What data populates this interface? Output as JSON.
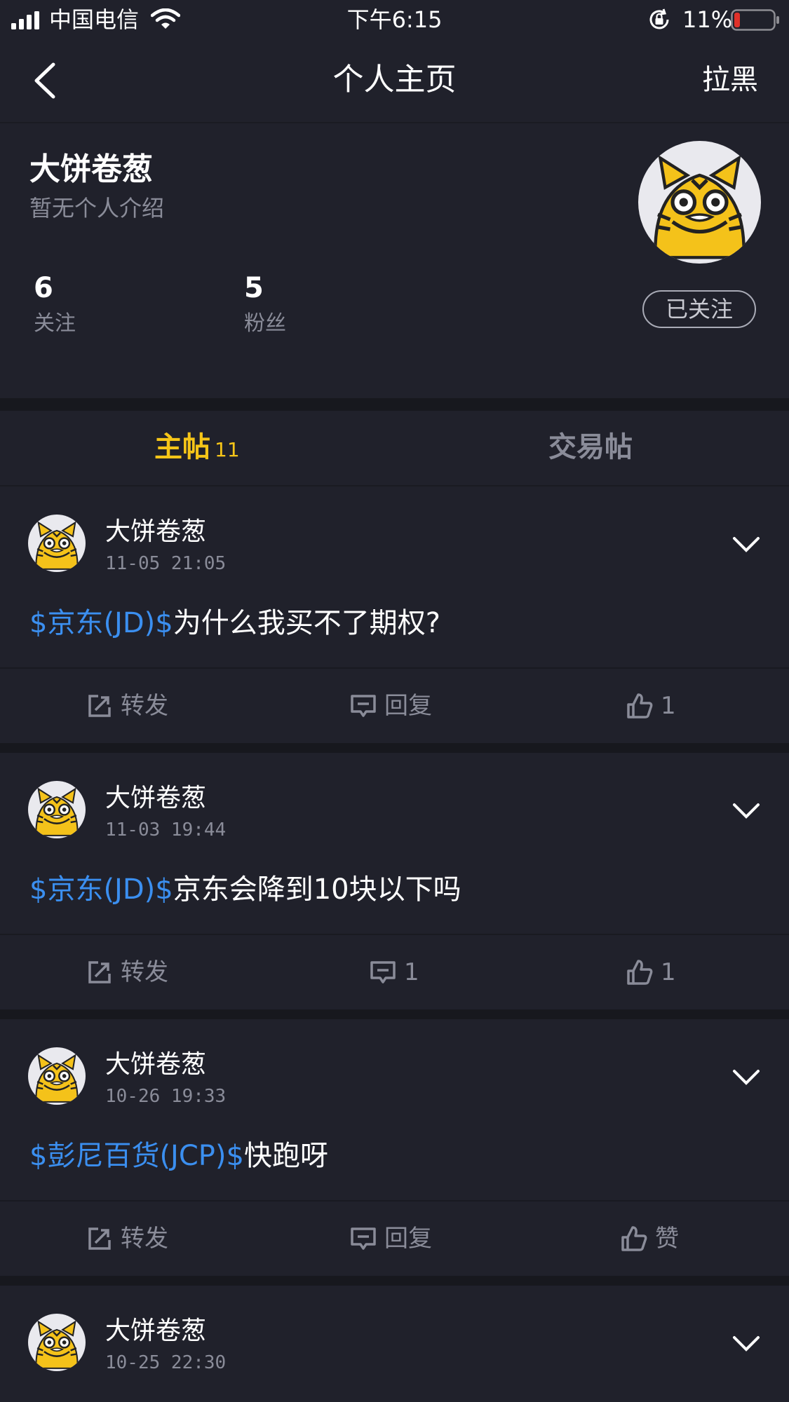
{
  "status_bar": {
    "carrier": "中国电信",
    "time": "下午6:15",
    "battery_pct": "11%",
    "battery_level": 0.11,
    "accent_battery": "#e0312a"
  },
  "navbar": {
    "back_icon": "chevron-left-icon",
    "title": "个人主页",
    "block_label": "拉黑"
  },
  "profile": {
    "name": "大饼卷葱",
    "bio": "暂无个人介绍",
    "following_count": "6",
    "following_label": "关注",
    "followers_count": "5",
    "followers_label": "粉丝",
    "follow_button": "已关注",
    "avatar_icon": "tiger-avatar-icon"
  },
  "tabs": {
    "main_label": "主帖",
    "main_count": "11",
    "trade_label": "交易帖",
    "active_color": "#f5c518"
  },
  "posts": [
    {
      "author": "大饼卷葱",
      "time": "11-05 21:05",
      "tag": "$京东(JD)$",
      "text": "为什么我买不了期权?",
      "share": "转发",
      "reply": "回复",
      "like": "1"
    },
    {
      "author": "大饼卷葱",
      "time": "11-03 19:44",
      "tag": "$京东(JD)$",
      "text": "京东会降到10块以下吗",
      "share": "转发",
      "reply": "1",
      "like": "1"
    },
    {
      "author": "大饼卷葱",
      "time": "10-26 19:33",
      "tag": "$彭尼百货(JCP)$",
      "text": "快跑呀",
      "share": "转发",
      "reply": "回复",
      "like": "赞"
    },
    {
      "author": "大饼卷葱",
      "time": "10-25 22:30"
    }
  ],
  "colors": {
    "background": "#20212b",
    "link": "#3b8ff0",
    "muted": "#8a8c99"
  }
}
